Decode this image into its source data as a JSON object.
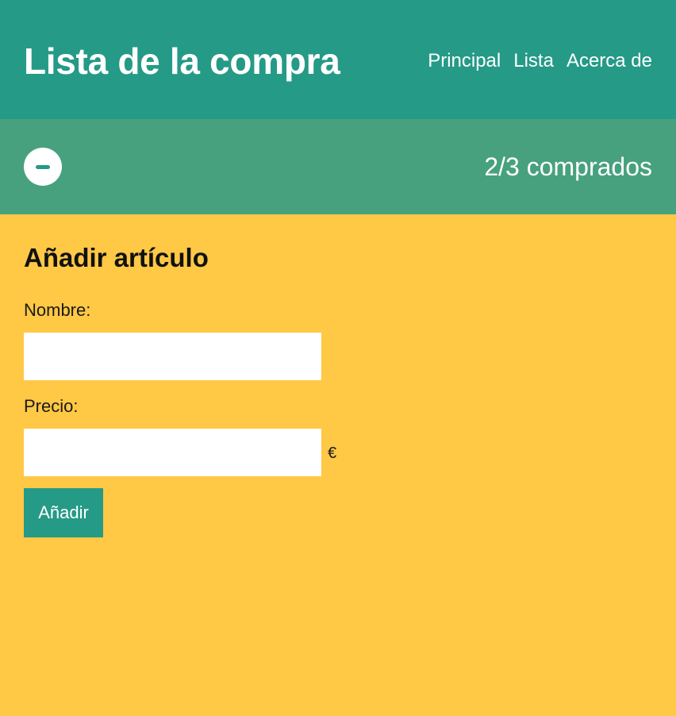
{
  "header": {
    "title": "Lista de la compra",
    "nav": [
      "Principal",
      "Lista",
      "Acerca de"
    ]
  },
  "status": {
    "toggle_icon": "minus-icon",
    "purchased_text": "2/3 comprados"
  },
  "form": {
    "title": "Añadir artículo",
    "name_label": "Nombre:",
    "name_value": "",
    "price_label": "Precio:",
    "price_value": "",
    "currency": "€",
    "submit_label": "Añadir"
  },
  "colors": {
    "header_bg": "#259A87",
    "status_bg": "#47A17F",
    "page_bg": "#FFC845",
    "button_bg": "#259A87"
  }
}
